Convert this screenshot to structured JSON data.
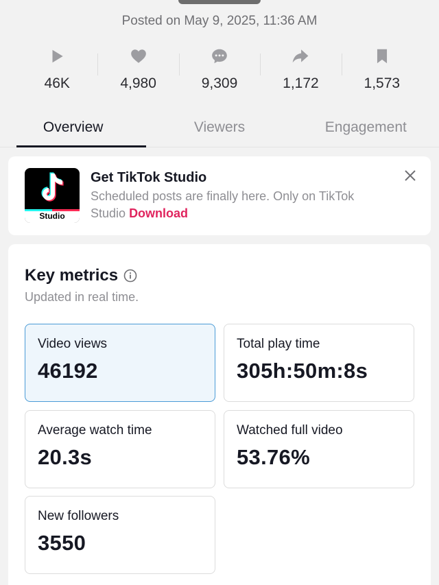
{
  "header": {
    "posted_text": "Posted on May 9, 2025, 11:36 AM"
  },
  "stats": [
    {
      "icon": "play-icon",
      "value": "46K"
    },
    {
      "icon": "heart-icon",
      "value": "4,980"
    },
    {
      "icon": "comment-icon",
      "value": "9,309"
    },
    {
      "icon": "share-icon",
      "value": "1,172"
    },
    {
      "icon": "bookmark-icon",
      "value": "1,573"
    }
  ],
  "tabs": [
    {
      "label": "Overview",
      "active": true
    },
    {
      "label": "Viewers",
      "active": false
    },
    {
      "label": "Engagement",
      "active": false
    }
  ],
  "banner": {
    "app_icon_label": "Studio",
    "title": "Get TikTok Studio",
    "text": "Scheduled posts are finally here. Only on TikTok Studio",
    "link": "Download"
  },
  "metrics": {
    "title": "Key metrics",
    "subtitle": "Updated in real time.",
    "cards": [
      {
        "label": "Video views",
        "value": "46192",
        "selected": true
      },
      {
        "label": "Total play time",
        "value": "305h:50m:8s",
        "selected": false
      },
      {
        "label": "Average watch time",
        "value": "20.3s",
        "selected": false
      },
      {
        "label": "Watched full video",
        "value": "53.76%",
        "selected": false
      },
      {
        "label": "New followers",
        "value": "3550",
        "selected": false
      }
    ]
  },
  "colors": {
    "accent_link": "#e0245e",
    "selected_card_bg": "#eef6fc",
    "selected_card_border": "#4a9bd6"
  }
}
